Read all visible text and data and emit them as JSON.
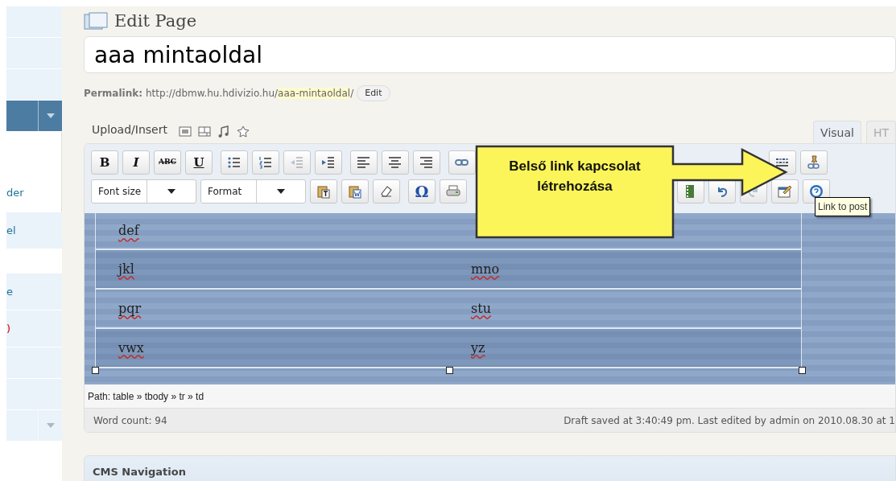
{
  "sidebar": {
    "groups": [
      [
        {
          "kind": "blank"
        },
        {
          "kind": "blank"
        },
        {
          "kind": "blank"
        },
        {
          "kind": "section",
          "selected": true
        },
        {
          "kind": "panel-link",
          "label": "der"
        },
        {
          "kind": "link",
          "label": "el"
        }
      ],
      [
        {
          "kind": "link",
          "label": "e"
        },
        {
          "kind": "link",
          "label": ")"
        },
        {
          "kind": "blank"
        },
        {
          "kind": "blank"
        },
        {
          "kind": "section",
          "selected": false
        }
      ]
    ]
  },
  "page": {
    "heading": "Edit Page",
    "title_field": {
      "value": "aaa mintaoldal"
    },
    "permalink": {
      "label": "Permalink:",
      "base": "http://dbmw.hu.hdivizio.hu/",
      "slug": "aaa-mintaoldal",
      "trail": "/",
      "button": "Edit"
    },
    "upload": {
      "label": "Upload/Insert"
    },
    "tabs": [
      {
        "label": "Visual",
        "selected": true
      },
      {
        "label": "HT",
        "selected": false
      }
    ],
    "toolbar": [
      [
        {
          "kind": "text",
          "label": "B"
        },
        {
          "kind": "text",
          "label": "I"
        },
        {
          "kind": "text",
          "label": "ABC"
        },
        {
          "kind": "text",
          "label": "U"
        },
        {
          "kind": "icon",
          "disabled": false
        },
        {
          "kind": "icon",
          "disabled": false
        },
        {
          "kind": "icon",
          "disabled": true
        },
        {
          "kind": "icon",
          "disabled": false
        },
        {
          "kind": "icon",
          "disabled": false
        },
        {
          "kind": "icon",
          "disabled": false
        },
        {
          "kind": "icon",
          "disabled": false
        },
        {
          "kind": "icon",
          "disabled": false
        },
        {
          "kind": "icon",
          "disabled": false
        },
        {
          "kind": "icon",
          "disabled": false
        }
      ],
      [
        {
          "kind": "select",
          "label": "Font size"
        },
        {
          "kind": "select",
          "label": "Format"
        },
        {
          "kind": "icon",
          "disabled": false
        },
        {
          "kind": "icon",
          "disabled": false
        },
        {
          "kind": "icon",
          "disabled": false
        },
        {
          "kind": "text",
          "label": "Ω"
        },
        {
          "kind": "icon",
          "disabled": false
        },
        {
          "kind": "icon",
          "disabled": false
        },
        {
          "kind": "icon",
          "disabled": false
        },
        {
          "kind": "icon",
          "disabled": true
        },
        {
          "kind": "icon",
          "disabled": false
        },
        {
          "kind": "icon",
          "disabled": false
        }
      ]
    ],
    "table": {
      "rows": [
        {
          "cells": [
            {
              "text": "def",
              "misspelled": true
            }
          ]
        },
        {
          "cells": [
            {
              "text": "jkl",
              "misspelled": true
            },
            {
              "text": "mno",
              "misspelled": true
            }
          ]
        },
        {
          "cells": [
            {
              "text": "pqr",
              "misspelled": true
            },
            {
              "text": "stu",
              "misspelled": true
            }
          ]
        },
        {
          "cells": [
            {
              "text": "vwx",
              "misspelled": true
            },
            {
              "text": "yz",
              "misspelled": true
            }
          ]
        }
      ]
    },
    "path": "Path: table » tbody » tr » td",
    "word_count": "Word count: 94",
    "draft_status": "Draft saved at 3:40:49 pm. Last edited by admin on 2010.08.30 at 1",
    "callout": "Belső link kapcsolat létrehozása",
    "tooltip": "Link to post",
    "cms_box": {
      "title": "CMS Navigation"
    }
  }
}
